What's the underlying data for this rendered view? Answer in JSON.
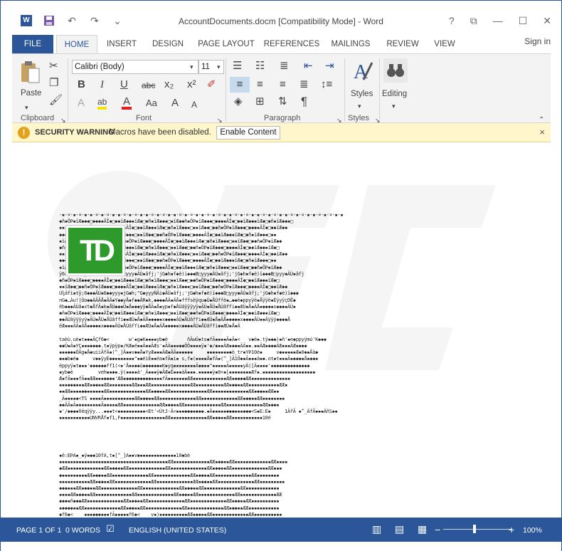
{
  "window": {
    "title": "AccountDocuments.docm [Compatibility Mode] - Word",
    "help": "?",
    "restore_ribbon": "⧉",
    "minimize": "—",
    "maximize": "☐",
    "close": "✕"
  },
  "qat": {
    "logo": "W",
    "undo": "↶",
    "redo": "↷",
    "more": "⌄"
  },
  "tabs": [
    "FILE",
    "HOME",
    "INSERT",
    "DESIGN",
    "PAGE LAYOUT",
    "REFERENCES",
    "MAILINGS",
    "REVIEW",
    "VIEW"
  ],
  "signin": "Sign in",
  "ribbon": {
    "clipboard_label": "Clipboard",
    "paste_label": "Paste",
    "font_label": "Font",
    "font_name": "Calibri (Body)",
    "font_size": "11",
    "paragraph_label": "Paragraph",
    "styles_label": "Styles",
    "styles_btn": "Styles",
    "editing_btn": "Editing",
    "bold": "B",
    "italic": "I",
    "underline": "U",
    "strike": "abc",
    "subscript": "x₂",
    "superscript": "x²",
    "highlight": "ab",
    "fontcolor": "A",
    "changecase": "Aa",
    "grow": "A",
    "shrink": "A",
    "texteffect": "A",
    "pilcrow": "¶"
  },
  "security": {
    "icon": "!",
    "title": "SECURITY WARNING",
    "message": "Macros have been disabled.",
    "button": "Enable Content",
    "close": "×"
  },
  "document": {
    "logo_text": "TD",
    "gibberish_top": "·▪·¤·▪·¤·▪·▪·¤·▪·¤·▪·▪·¤·▪·¤·▪·▪·¤·▪·¤·▪·▪·¤·▪·¤·▪·▪·¤·▪·¤·▪·▪·¤·▪·¤·▪·▪·¤·▪·¤·▪·▪·¤·▪·¤·▪·▪·¤·▪·¤·▪·▪\n◆ñ▪ÖÞ▪ïÆ◆◆◆□◆◆◆▪ÂÎ◆□◆◆ïÆ◆◆▪ïÆ◆□◆ñ▪ïÆ◆◆▪□▪ïÆ◆◆ñ▪ÖÞ▪ïÆ◆◆◆□◆◆◆▪ÂÎ◆□◆◆ïÆ◆◆▪ïÆ◆□◆ñ▪ïÆ◆◆▪□\n▪▪ïÆ◆◆□◆◆ñ▪ÖÞ▪ïÆ◆◆◆□◆◆◆▪ÂÎ◆□◆◆ïÆ◆◆▪ïÆ◆□◆ñ▪ïÆ◆◆▪□▪▪ïÆ◆◆□◆◆ñ▪ÖÞ▪ïÆ◆◆◆□◆◆◆▪ÂÎ◆□◆◆ïÆ◆◆\n◆◆◆▪ÂÎ◆□◆◆ïÆ◆◆▪ïÆ◆□◆ñ▪ïÆ◆◆▪□▪▪ïÆ◆◆□◆◆ñ▪ÖÞ▪ïÆ◆◆◆□◆◆◆▪ÂÎ◆□◆◆ïÆ◆◆▪ïÆ◆□◆ñ▪ïÆ◆◆▪□▪▪\n▪ïÆ◆□◆ñ▪ïÆ◆◆▪□▪▪ïÆ◆◆□◆◆ñ▪ÖÞ▪ïÆ◆◆◆□◆◆◆▪ÂÎ◆□◆◆ïÆ◆◆▪ïÆ◆□◆ñ▪ïÆ◆◆▪□▪▪ïÆ◆◆□◆◆ñ▪ÖÞ▪ïÆ◆◆\n◆ñ▪ÖÞ▪ïÆ◆◆◆□◆◆◆▪ÂÎ◆□◆◆ïÆ◆◆▪ïÆ◆□◆ñ▪ïÆ◆◆▪□▪▪ïÆ◆◆□◆◆ñ▪ÖÞ▪ïÆ◆◆◆□◆◆◆▪ÂÎ◆□◆◆ïÆ◆◆▪ïÆ◆□\n▪▪ïÆ◆◆□◆◆ñ▪ÖÞ▪ïÆ◆◆◆□◆◆◆▪ÂÎ◆□◆◆ïÆ◆◆▪ïÆ◆□◆ñ▪ïÆ◆◆▪□▪▪ïÆ◆◆□◆◆ñ▪ÖÞ▪ïÆ◆◆◆□◆◆◆▪ÂÎ◆□◆◆ïÆ◆◆\n◆◆◆▪ÂÎ◆□◆◆ïÆ◆◆▪ïÆ◆□◆ñ▪ïÆ◆◆▪□▪▪ïÆ◆◆□◆◆ñ▪ÖÞ▪ïÆ◆◆◆□◆◆◆▪ÂÎ◆□◆◆ïÆ◆◆▪ïÆ◆□◆ñ▪ïÆ◆◆▪□▪▪\n▪ïÆ◆□◆ñ▪ïÆ◆◆▪□▪▪ïÆ◆◆□◆◆ñ▪ÖÞ▪ïÆ◆◆◆□◆◆◆▪ÂÎ◆□◆◆ïÆ◆◆▪ïÆ◆□◆ñ▪ïÆ◆◆▪□▪▪ïÆ◆◆□◆◆ñ▪ÖÞ▪ïÆ◆◆\nÿ6◆£◆0◆;'jG◆h▪f◆è)ï◆◆◆B□yyy◆ÂÙ▪âfj;'jG◆h▪f◆è)ï◆◆◆B□yyy◆ÂÙ▪âfj;'jG◆h▪f◆è)ï◆◆◆B□yyy◆ÂÙ▪âfj\n◆ñ▪ÖÞ▪ïÆ◆◆◆□◆◆◆▪ÂÎ◆□◆◆ïÆ◆◆▪ïÆ◆□◆ñ▪ïÆ◆◆▪□▪▪ïÆ◆◆□◆◆ñ▪ÖÞ▪ïÆ◆◆◆□◆◆◆▪ÂÎ◆□◆◆ïÆ◆◆▪ïÆ◆□\n▪▪ïÆ◆◆□◆◆ñ▪ÖÞ▪ïÆ◆◆◆□◆◆◆▪ÂÎ◆□◆◆ïÆ◆◆▪ïÆ◆□◆ñ▪ïÆ◆◆▪□▪▪ïÆ◆◆□◆◆ñ▪ÖÞ▪ïÆ◆◆◆□◆◆◆▪ÂÎ◆□◆◆ïÆ◆◆\nÙ¾âfi▪tÿ;6◆◆◆ÂÙ▪6◆◆yyy▪jG◆h;\"G◆yyyÑÂi◆ÂÙ▪âfj;'jG◆h▪f◆è)ï◆◆◆B□yyy◆ÂÙ▪âfj;'jG◆h▪f◆è)ï◆◆◆\nnG◆…Àu!|Ùo◆◆ÀÃÃÅ▪ÂÄ▪Y◆◆yÅ▪f◆◆ÂR▪k,◆◆◆◆ÅÂ▪ÄÅ▪fffsèÿqu◆Ü▪ÅÙffè▪…◆◆è◆ppyÿè▪Åÿÿè▪ÉÿyÿçDË◆\nëb◆◆◆ÂÙâ▪xt◆ÅfÂ▪k▪ÅÙ◆◆▪Ü▪Å▪◆◆yÿ◆ÅÄ▪Å▪yp▪f◆ÅÙâÿÿÿyÿ▪ÂÙ▪ÅÙ▪ÅÙâffi◆▪ÆÙ▪Å▪ÄÅ▪◆◆◆▪x◆◆◆▪ÂÙ▪\n◆ñ▪ÖÞ▪ïÆ◆◆◆□◆◆◆▪ÂÎ◆□◆◆ïÆ◆◆▪ïÆ◆□◆ñ▪ïÆ◆◆▪□▪▪ïÆ◆◆□◆◆ñ▪ÖÞ▪ïÆ◆◆◆□◆◆◆▪ÂÎ◆□◆◆ïÆ◆◆▪ïÆ◆□\n◆◆ÂÙâÿÿÿyÿ▪ÂÙ▪ÅÙ▪ÅÙâffi◆▪ÆÙ▪Å▪ÄÅ▪◆◆◆▪x◆◆◆▪ÂÙ▪ÅÙâffi◆▪ÆÙ▪Å▪ÄÅ▪◆◆◆▪x◆◆◆▪ÂÙ▪▪Âÿÿÿ◆◆◆◆Å\nëÆ▪▪▪ÄÂ▪ÄÅ▪◆◆◆▪x◆◆◆▪ÂÙ▪ÅÙâffi◆▪ÆÙ▪Å▪ÄÅ▪◆◆◆▪x◆◆◆▪ÂÙ▪ÅÙâffi◆▪ÆÙ▪Å▪Â\n\ntaèù.uè▪t▪◆▪ÃÇf6◆<       w'▪g▪K▪▪▪▪yb◆è       ñÃwÜ▪ts◆fÃ▪▪▪▪Ã▪Ã▪<   v◆è▪.tÿ▪◆◆)▪ñ'▪e◆ppyÿmú'K◆◆◆\n◆◆Ü▪Ã▪YÇ▪▪▪◆◆◆◆.t▪ÿpÿp▪/KÆ▪é▪▪Ã▪▪ÃÆs'▪ÃÄ▪▪▪◆◆ÖÖ▪▪▪▪ÿ▪'◆/◆▪▪ÄÆ▪◆◆▪ÄÃ▪▪.▪▪ÄÆ▪◆◆◆ÄÆ▪▪▪ÄÆ▪◆◆◆\n▪▪▪◆◆▪ÖÄg▪Å◆uiiÃfÄ▪(^_]Ã▪▪v◆▪Å▪YyÆ▪▪▪ÂÆ▪ÂÃ▪▪▪▪▪▪     ▪▪▪▪▪▪▪▪◆ò_tr▪YÞ10é▪     v◆▪▪▪▪▪Æ▪0◆▪Åà◆\n◆▪◆b◆è◆     v◆▪ÿyÉ◆◆▪▪▪▪▪▪▪\"▪◆éiÉ▪▪éa▪fÃ▪i▪ s,f▪(▪▪▪▪Å▪fÃ▪(^_]Ã1Ö◆▪Ã▪▪▪ä▪◆.ot▪t▪▪▪Ã▪◆◆◆▪Å▪◆◆▪\nèppyÿ▪t◆▪▪'◆◆◆◆◆◆ff1(<▪'Å▪▪◆◆ü◆◆◆◆◆◆▪K▪yq▪▪▪▪▪▪▪▪Ä◆◆▪▪\"▪▪▪▪▪Ä▪▪▪▪▪yÄ([Ä▪▪▪▪'▪◆◆◆◆◆◆◆◆◆◆◆◆◆\n▪yb◆è         veh▪▪◆▪.ÿ(▪▪▪▪à'_Ã▪▪▪ÿ◆ÂÆ▪Ê▪▪▪àÃ▪▪▪.▪▪▪▪▪ÿ▪0÷▪[▪▪▪▪▪▪▪▪Æf▪.▪▪▪▪▪▪▪▪▪▪▪▪▪▪▪▪▪▪▪\nÆ▪fÃ▪▪▪fÃ▪▪ÆÆ▪▪▪◆◆◆▪'ÆÆ▪◆◆◆◆◆◆◆◆◆▪▪▪▪fÃ▪▪▪▪▪▪▪ÆÆ▪▪▪▪▪▪▪▪▪▪▪▪ÆÆ▪◆◆◆◆ÆÆ▪▪▪▪▪▪▪▪▪▪▪▪▪▪\n▪▪▪◆◆◆▪▪▪ÆÆ▪◆◆▪▪ÆÆ▪▪▪▪▪▪▪▪ÆÆ▪▪▪ÆÆ▪▪▪▪▪▪▪▪▪▪▪▪▪▪ÆÆ▪▪▪▪▪▪▪▪▪▪ÆÆ▪◆◆▪▪ÆÆ▪▪▪▪▪▪▪▪▪▪▪ÆÆ▪\n▪▪ÆÆ▪▪▪▪◆◆▪▪▪▪▪▪ÆÆ▪▪▪▪▪▪▪▪▪▪▪▪▪ÆÆ▪◆◆▪▪ÆÆ▪▪▪▪▪▪▪▪▪▪▪▪▪ÆÆ▪▪▪▪▪▪▪▪▪▪▪▪▪ÆÆ▪◆◆▪▪ÆÆ▪▪\n_Ã▪▪▪▪◆<TS ▪▪▪▪Ã▪▪▪▪▪▪▪▪▪▪▪ÆÆ▪◆◆▪▪ÆÆ▪▪▪▪▪▪▪▪▪▪▪▪▪ÆÆ▪▪▪▪▪▪▪▪▪▪▪▪▪ÆÆ▪◆◆▪▪ÆÆ▪▪▪▪▪▪▪▪\n◆◆ÂÃ▪Ã▪▪▪▪▪▪▪▪▪Ã▪▪▪▪▪ÆÆ▪▪▪▪▪▪▪▪▪▪▪▪▪ÆÆ▪◆◆▪▪ÆÆ▪▪▪▪▪▪▪▪▪▪▪▪▪ÆÆ▪▪▪▪▪▪▪▪▪▪▪▪▪ÆÆ▪◆◆▪\n▪'/◆◆◆▪ñëqÿÿy...▪▪▪t<▪▪▪▪▪▪▪▪▪▪<Et'<ÙtJ-Ä<▪▪▪◆◆◆▪◆◆◆.▪Ã▪▪▪▪▪◆◆◆▪▪▪◆◆◆<S▪E:E▪     1ÄfÃ ▪^_ÄfÃ▪▪▪ÄñS▪▪\n▪▪▪▪▪▪▪▪▪▪▪UNVRÅf▪f1,F▪▪▪▪▪▪▪▪▪▪▪▪▪▪▪▪ÆÆ▪▪▪▪▪▪▪▪▪▪▪▪▪ÆÆ▪◆◆▪▪ÆÆ▪▪▪▪▪▪▪▪▪▪▪10é",
    "gibberish_bottom": "▪ë:EÞÄ▪_▪ÿ▪◆◆10fÄ,t▪[^_]Ã▪▪v◆▪▪▪▪▪▪▪▪▪▪▪▪▪10◆bè\n▪▪▪▪▪▪▪▪▪▪▪▪▪▪▪▪▪▪▪▪▪▪▪▪▪▪▪▪▪▪▪▪▪▪▪▪▪▪▪ÆÆ▪▪▪▪▪▪▪▪▪▪▪▪▪ÆÆ▪◆◆▪▪ÆÆ▪▪▪▪▪▪▪▪▪▪▪▪▪ÆÆ▪▪▪▪\n◆ÆÆ▪▪▪▪▪▪▪▪▪▪▪▪▪ÆÆ▪◆◆▪▪ÆÆ▪▪▪▪▪▪▪▪▪▪▪▪▪ÆÆ▪▪▪▪▪▪▪▪▪▪▪▪▪ÆÆ▪◆◆▪▪ÆÆ▪▪▪▪▪▪▪▪▪▪▪▪▪ÆÆ▪▪▪\n◆▪▪▪▪▪▪▪▪▪ÆÆ▪◆◆▪▪ÆÆ▪▪▪▪▪▪▪▪▪▪▪▪▪ÆÆ▪▪▪▪▪▪▪▪▪▪▪▪▪ÆÆ▪◆◆▪▪ÆÆ▪▪▪▪▪▪▪▪▪▪▪▪▪ÆÆ▪▪▪▪▪▪▪▪\n▪▪▪▪▪▪▪▪▪▪▪ÆÆ▪◆◆▪▪ÆÆ▪▪▪▪▪▪▪▪▪▪▪▪▪ÆÆ▪▪▪▪▪▪▪▪▪▪▪▪▪ÆÆ▪◆◆▪▪ÆÆ▪▪▪▪▪▪▪▪▪▪▪▪▪ÆÆ▪▪▪▪▪▪▪▪▪\n◆◆◆▪▪▪ÆÆ▪◆◆▪▪ÆÆ▪▪▪▪▪▪▪▪▪▪▪▪▪ÆÆ▪▪▪▪▪▪▪▪▪▪▪▪▪ÆÆ▪◆◆▪▪ÆÆ▪▪▪▪▪▪▪▪▪▪▪▪▪ÆÆ▪▪▪▪▪▪▪▪▪▪▪▪\n▪▪▪▪ÆÆ▪◆◆▪▪ÆÆ▪▪▪▪▪▪▪▪▪▪▪▪▪ÆÆ▪▪▪▪▪▪▪▪▪▪▪▪▪ÆÆ▪◆◆▪▪ÆÆ▪▪▪▪▪▪▪▪▪▪▪▪▪ÆÆ▪▪▪▪▪▪▪▪▪▪▪▪▪ÆÆ\n◆◆◆▪ñ◆◆◆ÆÆ▪▪▪▪▪▪▪▪▪▪▪▪▪ÆÆ▪◆◆▪▪ÆÆ▪▪▪▪▪▪▪▪▪▪▪▪▪ÆÆ▪▪▪▪▪▪▪▪▪▪▪▪▪ÆÆ▪◆◆▪▪ÆÆ▪▪▪▪▪▪▪▪▪▪\n▪◆◆◆◆▪▪ÆÆ▪▪▪▪▪▪▪▪▪▪▪▪▪ÆÆ▪◆◆▪▪ÆÆ▪▪▪▪▪▪▪▪▪▪▪▪▪ÆÆ▪▪▪▪▪▪▪▪▪▪▪▪▪ÆÆ▪◆◆▪▪ÆÆ▪▪▪▪▪▪▪▪▪▪▪\n◆f6◆<    ▪▪▪◆◆◆▪▪▪fÃ▪▪▪▪▪f6◆<    v▪)▪▪▪▪▪▪▪▪▪▪ÆÆ▪◆◆▪▪ÆÆ▪▪▪▪▪▪▪▪▪▪▪▪▪ÆÆ▪▪▪▪▪▪▪▪▪▪"
  },
  "status": {
    "page": "PAGE 1 OF 1",
    "words": "0 WORDS",
    "language": "ENGLISH (UNITED STATES)",
    "zoom": "100%",
    "zoom_minus": "−",
    "zoom_plus": "+"
  },
  "colors": {
    "accent": "#2b579a",
    "warning_bg": "#fff6cc",
    "td_green": "#2e9a2c"
  }
}
